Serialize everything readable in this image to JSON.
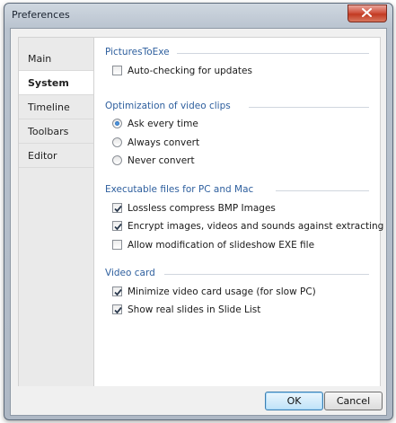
{
  "window": {
    "title": "Preferences"
  },
  "sidebar": {
    "items": [
      {
        "label": "Main"
      },
      {
        "label": "System"
      },
      {
        "label": "Timeline"
      },
      {
        "label": "Toolbars"
      },
      {
        "label": "Editor"
      }
    ],
    "selected": "System"
  },
  "sections": {
    "pictures_to_exe": {
      "title": "PicturesToExe",
      "auto_check": {
        "label": "Auto-checking for updates",
        "checked": false
      }
    },
    "optimization": {
      "title": "Optimization of video clips",
      "options": [
        {
          "label": "Ask every time",
          "selected": true
        },
        {
          "label": "Always convert",
          "selected": false
        },
        {
          "label": "Never convert",
          "selected": false
        }
      ]
    },
    "executable": {
      "title": "Executable files for PC and Mac",
      "lossless": {
        "label": "Lossless compress BMP Images",
        "checked": true
      },
      "encrypt": {
        "label": "Encrypt images, videos and sounds against extracting",
        "checked": true
      },
      "allow_mod": {
        "label": "Allow modification of slideshow EXE file",
        "checked": false
      }
    },
    "video_card": {
      "title": "Video card",
      "minimize": {
        "label": "Minimize video card usage (for slow PC)",
        "checked": true
      },
      "show_real": {
        "label": "Show real slides in Slide List",
        "checked": true
      }
    }
  },
  "buttons": {
    "ok": "OK",
    "cancel": "Cancel"
  },
  "colors": {
    "section_title": "#2e5f9e",
    "close_button": "#c23a22",
    "check": "#2b3a4e"
  }
}
